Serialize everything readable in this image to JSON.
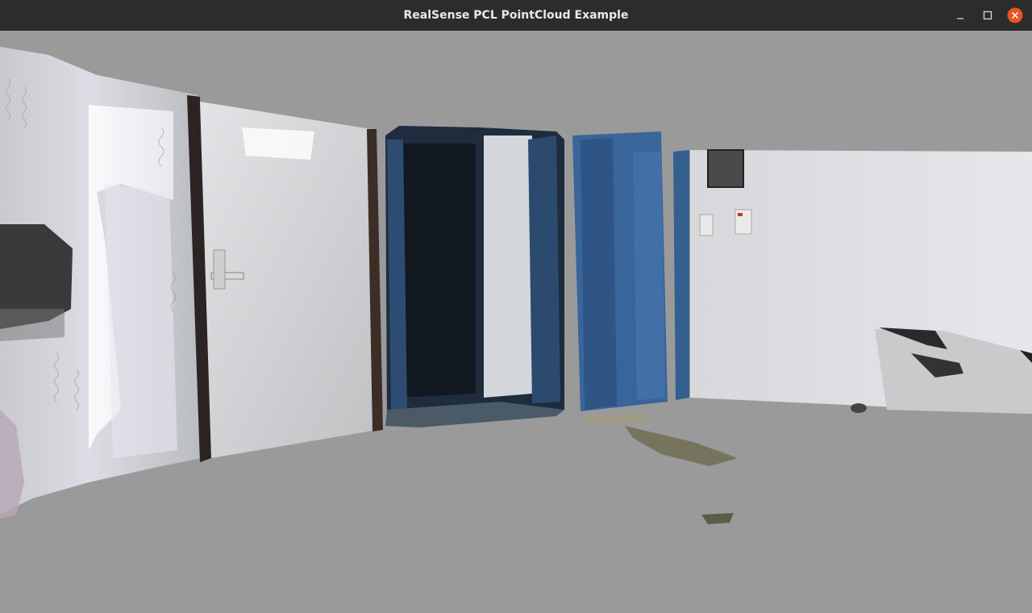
{
  "window": {
    "title": "RealSense PCL PointCloud Example",
    "controls": {
      "minimize": "minimize-icon",
      "maximize": "maximize-icon",
      "close": "close-icon"
    },
    "close_color": "#e95420",
    "titlebar_color": "#2c2c2c"
  },
  "viewport": {
    "content": "point-cloud-render",
    "background_color": "#9a9a9a"
  }
}
